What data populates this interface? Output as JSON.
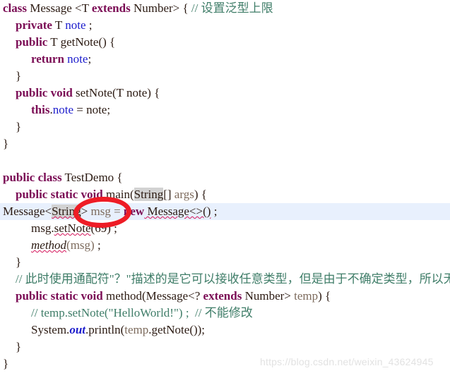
{
  "editor": {
    "background_color": "#ffffff",
    "highlight_line_color": "#e8f0fd",
    "selection_color": "#d2d2d2",
    "keyword_color": "#7a0b54",
    "field_color": "#1c1ccc",
    "comment_color": "#3f7d68",
    "variable_color": "#7d6b5d",
    "annotation_color": "#ee1c25",
    "error_underline_color": "#d4145a"
  },
  "annotation": {
    "shape": "ellipse",
    "target_text": "String",
    "color": "#ee1c25"
  },
  "watermark": {
    "text": "https://blog.csdn.net/weixin_43624945"
  },
  "code": {
    "line01": {
      "kw_class": "class",
      "name": "Message",
      "generic_open": "<T ",
      "kw_extends": "extends",
      "generic_close": " Number> { ",
      "comment": "// 设置泛型上限"
    },
    "line02": {
      "kw": "private",
      "rest": " T ",
      "field": "note",
      "tail": " ;"
    },
    "line03": {
      "kw": "public",
      "rest": " T getNote() {"
    },
    "line04": {
      "kw": "return",
      "field": " note",
      "tail": ";"
    },
    "line05": {
      "text": "}"
    },
    "line06": {
      "kw": "public void",
      "rest": " setNote(T note) {"
    },
    "line07": {
      "kw": "this",
      "dot": ".",
      "field": "note",
      "tail": " = note;"
    },
    "line08": {
      "text": "}"
    },
    "line09": {
      "text": "}"
    },
    "line10": {
      "text": ""
    },
    "line11": {
      "kw": "public class",
      "rest": " TestDemo {"
    },
    "line12": {
      "kw": "public static void",
      "mid": " main(",
      "sel": "String",
      "tail": "[] ",
      "args": "args",
      "end": ") {"
    },
    "line13": {
      "type": "Message",
      "lt": "<",
      "sel": "String",
      "gt": ">",
      "var": " msg = ",
      "kw_new": "new",
      "ctor": " Message<>()",
      "semi": " ;"
    },
    "line14": {
      "obj": "msg.",
      "call": "setNote",
      "args": "(69)",
      "semi": " ;"
    },
    "line15": {
      "mth": "method",
      "args": "(msg)",
      "semi": " ;"
    },
    "line16": {
      "text": "}"
    },
    "line17": {
      "comment": "// 此时使用通配符\"？\"描述的是它可以接收任意类型，但是由于不确定类型，所以无法修改"
    },
    "line18": {
      "kw": "public static void",
      "mid": " method(Message<? ",
      "kw2": "extends",
      "tail": " Number> ",
      "param": "temp",
      "end": ") {"
    },
    "line19": {
      "comment": "// temp.setNote(\"HelloWorld!\") ;  // 不能修改"
    },
    "line20": {
      "sys": "System.",
      "out": "out",
      "print": ".println(",
      "param": "temp",
      "rest": ".getNote());"
    },
    "line21": {
      "text": "}"
    },
    "line22": {
      "text": "}"
    }
  }
}
